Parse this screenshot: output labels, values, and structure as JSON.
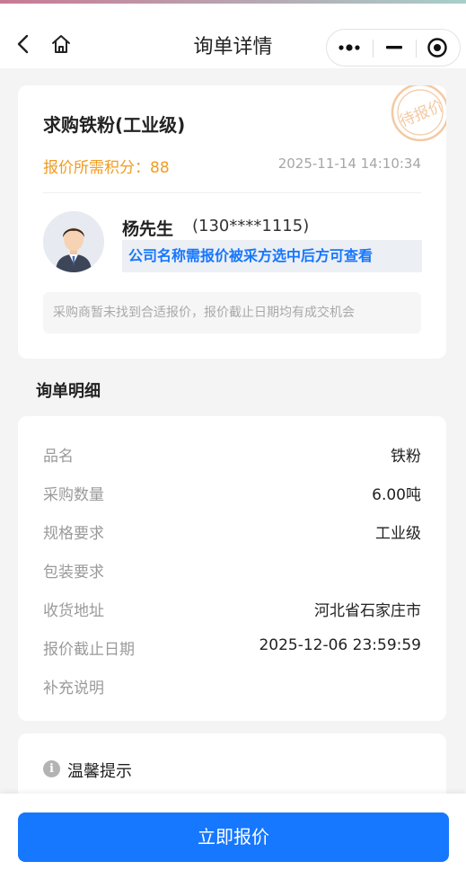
{
  "header": {
    "title": "询单详情",
    "back_icon": "chevron-left-icon",
    "home_icon": "home-icon",
    "capsule": {
      "more_icon": "more-dots-icon",
      "minimize_icon": "minimize-icon",
      "close_icon": "target-circle-icon"
    },
    "accent_gradient": [
      "#c97995",
      "#a7cfc8"
    ]
  },
  "inquiry": {
    "product_title": "求购铁粉(工业级)",
    "points_label": "报价所需积分：88",
    "timestamp": "2025-11-14 14:10:34",
    "stamp_text": "待报价",
    "buyer": {
      "name": "杨先生",
      "phone": "(130****1115)",
      "company_hint": "公司名称需报价被采方选中后方可查看"
    },
    "note": "采购商暂未找到合适报价，报价截止日期均有成交机会"
  },
  "details": {
    "section_title": "询单明细",
    "rows": [
      {
        "label": "品名",
        "value": "铁粉"
      },
      {
        "label": "采购数量",
        "value": "6.00吨"
      },
      {
        "label": "规格要求",
        "value": "工业级"
      },
      {
        "label": "包装要求",
        "value": ""
      },
      {
        "label": "收货地址",
        "value": "河北省石家庄市"
      },
      {
        "label": "报价截止日期",
        "value": "2025-12-06 23:59:59"
      },
      {
        "label": "补充说明",
        "value": ""
      }
    ]
  },
  "tips": {
    "icon": "info-icon",
    "title": "温馨提示",
    "icon_glyph": "i"
  },
  "footer": {
    "submit_label": "立即报价"
  },
  "colors": {
    "primary": "#1677ff",
    "points": "#f29c1f",
    "stamp": "#f3c9a3",
    "background": "#f4f4f4"
  }
}
